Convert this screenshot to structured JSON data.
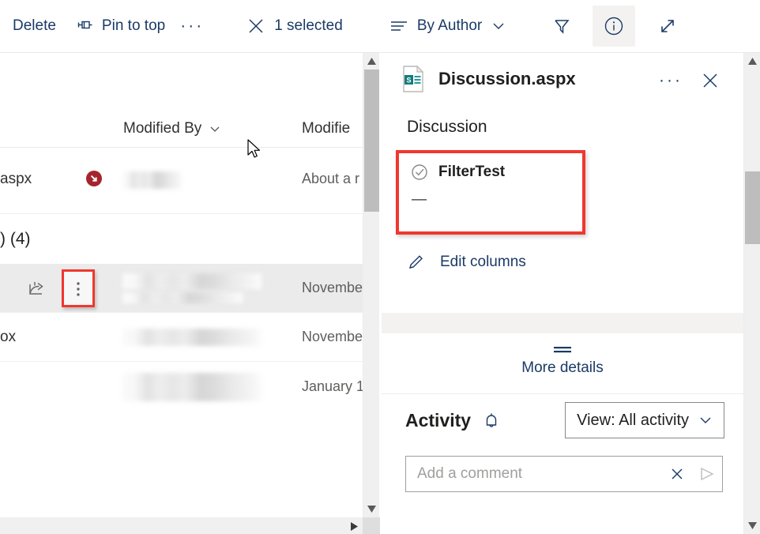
{
  "commandbar": {
    "delete_label": "Delete",
    "pin_label": "Pin to top",
    "overflow_label": "···",
    "selection_label": "1 selected",
    "groupby_label": "By Author",
    "icons": {
      "pin": "pin-icon",
      "close_selection": "close-icon",
      "groupby": "group-by-icon",
      "chevron": "chevron-down-icon",
      "filter": "filter-icon",
      "info": "info-icon",
      "expand": "expand-icon"
    },
    "accent_color": "#1b3a66",
    "active_bg": "#f3f2f1"
  },
  "list": {
    "columns": [
      {
        "label": "Modified By",
        "sortable": true
      },
      {
        "label": "Modifie",
        "sortable": false
      }
    ],
    "rows": [
      {
        "name": "aspx",
        "badge": "sync-error-badge",
        "badge_color": "#a4262c",
        "modified_by": "",
        "modified": "About a r",
        "selected": false
      }
    ],
    "group_header": ") (4)",
    "group_rows": [
      {
        "name": "",
        "modified": "Novembe",
        "selected": true
      },
      {
        "name": "ox",
        "modified": "Novembe",
        "selected": false
      },
      {
        "name": "",
        "modified": "January 1",
        "selected": false
      }
    ],
    "row_actions": {
      "share": "share-icon",
      "more": "more-vertical-icon"
    }
  },
  "details": {
    "file_name": "Discussion.aspx",
    "file_icon": "sharepoint-page-icon",
    "overflow_label": "···",
    "section_title": "Discussion",
    "property": {
      "label": "FilterTest",
      "value": "—",
      "icon": "circle-check-icon"
    },
    "edit_columns_label": "Edit columns",
    "edit_columns_icon": "pencil-icon",
    "more_details_label": "More details",
    "activity_label": "Activity",
    "activity_bell_icon": "bell-icon",
    "view_filter_label": "View: All activity",
    "comment_placeholder": "Add a comment",
    "comment_value": "",
    "comment_clear_icon": "close-icon",
    "comment_send_icon": "send-icon",
    "highlight_color": "#f0372e",
    "panel_bg": "#f3f2f1"
  },
  "scrollbars": {
    "list_vertical": {
      "up": "▲",
      "down": "▼"
    },
    "list_horizontal": {
      "right": "▶"
    },
    "details_vertical": {
      "up": "▲",
      "down": "▼"
    }
  }
}
